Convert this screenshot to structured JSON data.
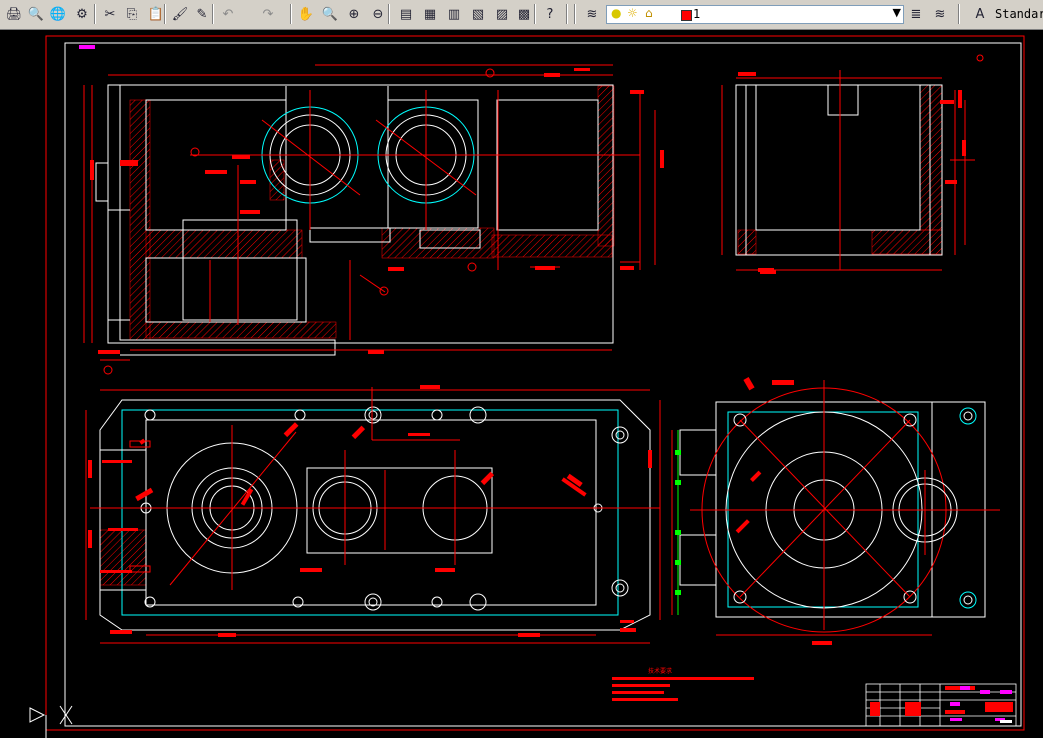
{
  "toolbar": {
    "buttons": [
      {
        "name": "publish-icon",
        "glyph": "🖨"
      },
      {
        "name": "plot-preview-icon",
        "glyph": "🔍"
      },
      {
        "name": "publish-web-icon",
        "glyph": "🌐"
      },
      {
        "name": "etransmit-icon",
        "glyph": "⚙"
      },
      {
        "name": "cut-icon",
        "glyph": "✂"
      },
      {
        "name": "copy-icon",
        "glyph": "⎘"
      },
      {
        "name": "paste-icon",
        "glyph": "📋"
      },
      {
        "name": "match-properties-icon",
        "glyph": "🖌"
      },
      {
        "name": "block-editor-icon",
        "glyph": "✎"
      },
      {
        "name": "undo-icon",
        "glyph": "↶"
      },
      {
        "name": "redo-icon",
        "glyph": "↷"
      },
      {
        "name": "pan-icon",
        "glyph": "✋"
      },
      {
        "name": "zoom-realtime-icon",
        "glyph": "🔍"
      },
      {
        "name": "zoom-window-icon",
        "glyph": "⊕"
      },
      {
        "name": "zoom-previous-icon",
        "glyph": "⊖"
      },
      {
        "name": "properties-icon",
        "glyph": "▤"
      },
      {
        "name": "design-center-icon",
        "glyph": "▦"
      },
      {
        "name": "tool-palettes-icon",
        "glyph": "▥"
      },
      {
        "name": "sheet-set-icon",
        "glyph": "▧"
      },
      {
        "name": "markup-icon",
        "glyph": "▨"
      },
      {
        "name": "calculator-icon",
        "glyph": "▩"
      },
      {
        "name": "help-icon",
        "glyph": "?"
      }
    ],
    "layer_manager_icon": "layers-icon",
    "layer_current": "1",
    "layer_color": "#ff0000",
    "text_style": "Standard"
  },
  "drawing": {
    "text_lines": [
      "技术要求"
    ],
    "colors": {
      "background": "#000000",
      "geometry": "#ffffff",
      "dimension": "#ff0000",
      "center": "#ff0000",
      "hidden": "#00ffff",
      "hatch": "#ff0000",
      "magenta": "#ff00ff",
      "green": "#00ff00"
    }
  }
}
